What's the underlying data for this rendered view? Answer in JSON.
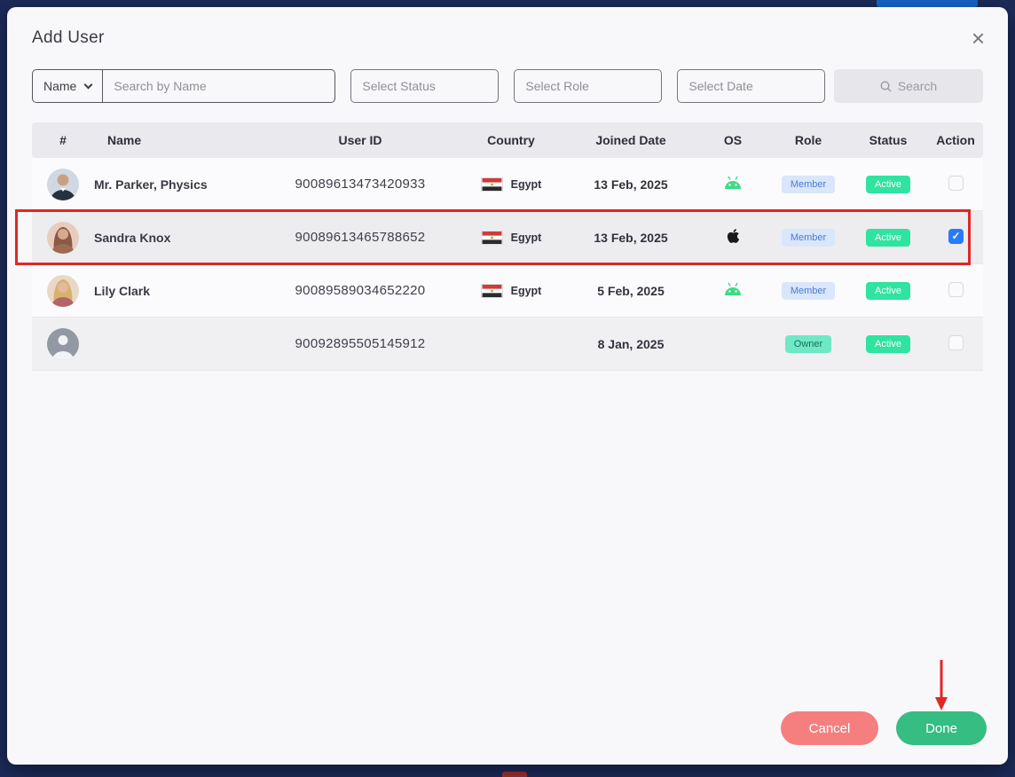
{
  "modal": {
    "title": "Add User",
    "close_glyph": "×"
  },
  "filters": {
    "name_dropdown": {
      "label": "Name"
    },
    "search": {
      "placeholder": "Search by Name"
    },
    "status": {
      "placeholder": "Select Status"
    },
    "role": {
      "placeholder": "Select Role"
    },
    "date": {
      "placeholder": "Select Date"
    },
    "search_button": {
      "label": "Search"
    }
  },
  "table": {
    "headers": [
      "#",
      "Name",
      "User ID",
      "Country",
      "Joined Date",
      "OS",
      "Role",
      "Status",
      "Action"
    ],
    "rows": [
      {
        "name": "Mr. Parker, Physics",
        "user_id": "90089613473420933",
        "country": "Egypt",
        "joined": "13 Feb, 2025",
        "os": "android",
        "role": "Member",
        "status": "Active",
        "checked": false,
        "avatar": "male-photo"
      },
      {
        "name": "Sandra Knox",
        "user_id": "90089613465788652",
        "country": "Egypt",
        "joined": "13 Feb, 2025",
        "os": "apple",
        "role": "Member",
        "status": "Active",
        "checked": true,
        "avatar": "female-photo"
      },
      {
        "name": "Lily Clark",
        "user_id": "90089589034652220",
        "country": "Egypt",
        "joined": "5 Feb, 2025",
        "os": "android",
        "role": "Member",
        "status": "Active",
        "checked": false,
        "avatar": "female-photo"
      },
      {
        "name": "",
        "user_id": "90092895505145912",
        "country": "",
        "joined": "8 Jan, 2025",
        "os": "",
        "role": "Owner",
        "status": "Active",
        "checked": false,
        "avatar": "placeholder"
      }
    ]
  },
  "footer": {
    "cancel_label": "Cancel",
    "done_label": "Done"
  },
  "colors": {
    "page_background": "#1d2a5a",
    "modal_background": "#f8f8fa",
    "member_badge": "#d9e6fb",
    "owner_badge": "#6fe8c8",
    "active_badge": "#2fe3a0",
    "cancel_button": "#f57f7f",
    "done_button": "#35bd82",
    "checkbox_checked": "#2979ff",
    "annotation_red": "#e02626",
    "android_green": "#3ddc84"
  },
  "icons": {
    "search": "magnifier",
    "android": "android-robot-head",
    "apple": "apple-logo",
    "flag": "egypt-flag"
  }
}
